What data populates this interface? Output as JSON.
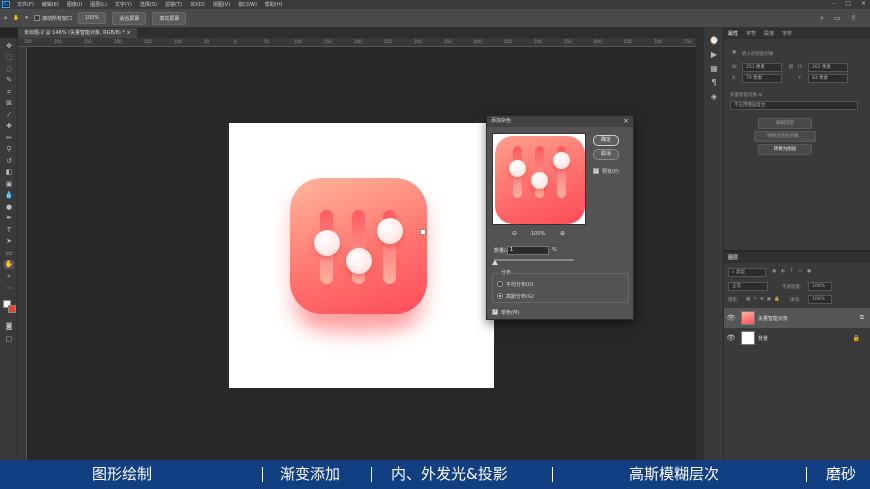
{
  "menubar": {
    "app_logo": "Ps",
    "items": [
      "文件(F)",
      "编辑(E)",
      "图像(I)",
      "图层(L)",
      "文字(Y)",
      "选择(S)",
      "滤镜(T)",
      "3D(D)",
      "视图(V)",
      "窗口(W)",
      "帮助(H)"
    ]
  },
  "optionsbar": {
    "checkbox_label": "滚动所有窗口",
    "zoom": "100%",
    "fit_button": "适合屏幕",
    "fill_button": "填充屏幕"
  },
  "document": {
    "tab_title": "未标题-2 @ 146% (矢量智能对象, RGB/8) *"
  },
  "ruler": {
    "h_ticks": [
      "350",
      "300",
      "250",
      "200",
      "150",
      "100",
      "50",
      "0",
      "50",
      "100",
      "150",
      "200",
      "250",
      "300",
      "350",
      "400",
      "450",
      "500",
      "550",
      "600",
      "650",
      "700",
      "750"
    ]
  },
  "properties": {
    "tabs": [
      "属性",
      "字符",
      "段落",
      "字形"
    ],
    "object_type": "嵌入的智能对象",
    "w_label": "W:",
    "w_value": "251 像素",
    "h_label": "H:",
    "h_value": "262 像素",
    "x_label": "X:",
    "x_value": "79 像素",
    "y_label": "Y:",
    "y_value": "83 像素",
    "source_label": "矢量智能对象.ai",
    "source_value": "不应用图层复合",
    "btn_edit": "编辑内容",
    "btn_convert_linked": "转换为链接对象...",
    "btn_to_layers": "转换为图层"
  },
  "layers": {
    "tabs": [
      "图层"
    ],
    "search_placeholder": "类型",
    "blend_mode": "正常",
    "opacity_label": "不透明度:",
    "opacity_value": "100%",
    "lock_label": "锁定:",
    "fill_label": "填充:",
    "fill_value": "100%",
    "rows": [
      {
        "name": "矢量智能对象",
        "selected": true
      },
      {
        "name": "背景",
        "selected": false
      }
    ]
  },
  "dialog": {
    "title": "添加杂色",
    "ok": "确定",
    "cancel": "取消",
    "preview_label": "预览(P)",
    "preview_checked": true,
    "zoom": "100%",
    "amount_label": "数量(A):",
    "amount_value": "1",
    "amount_unit": "%",
    "amount_level_fraction": 0.01,
    "distribution_label": "分布",
    "uniform_label": "平均分布(U)",
    "gaussian_label": "高斯分布(G)",
    "selected_distribution": "gaussian",
    "mono_label": "单色(M)",
    "mono_checked": true
  },
  "banner": {
    "items": [
      "图形绘制",
      "渐变添加",
      "内、外发光&投影",
      "高斯模糊层次",
      "磨砂"
    ],
    "color": "#123f82"
  },
  "colors": {
    "icon_gradient_start": "#ffb69c",
    "icon_gradient_end": "#ff4c5a"
  }
}
